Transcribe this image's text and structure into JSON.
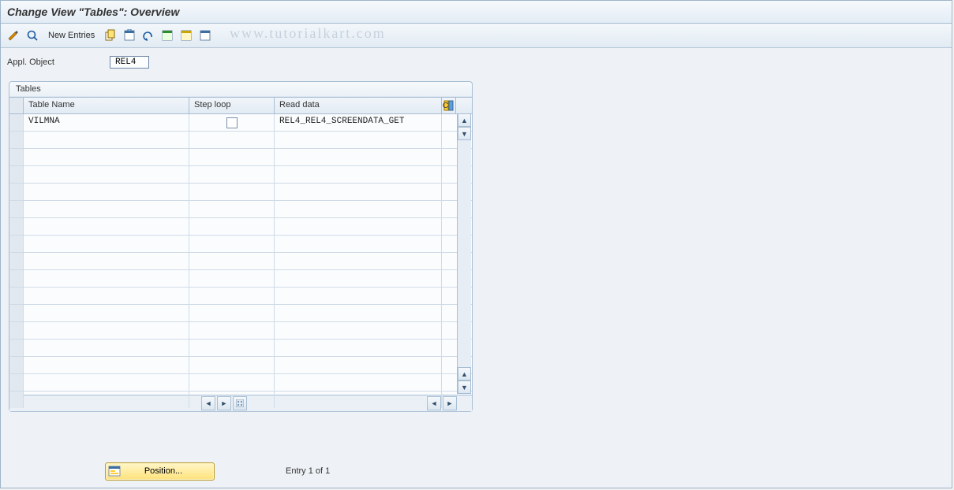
{
  "header": {
    "title": "Change View \"Tables\": Overview"
  },
  "toolbar": {
    "new_entries": "New Entries"
  },
  "watermark": "www.tutorialkart.com",
  "form": {
    "appl_object_label": "Appl. Object",
    "appl_object_value": "REL4"
  },
  "tablebox": {
    "title": "Tables",
    "columns": {
      "name": "Table Name",
      "step": "Step loop",
      "read": "Read data",
      "last": "C"
    },
    "rows": [
      {
        "name": "VILMNA",
        "step_checked": false,
        "read": "REL4_REL4_SCREENDATA_GET"
      }
    ],
    "empty_rows": 16
  },
  "footer": {
    "position_label": "Position...",
    "entry_text": "Entry 1 of 1"
  }
}
